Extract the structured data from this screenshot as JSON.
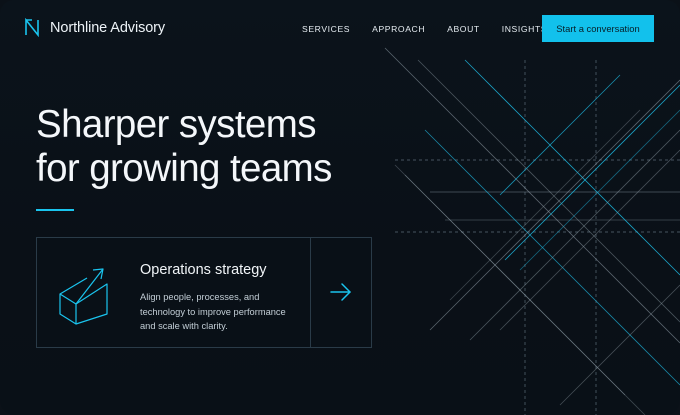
{
  "header": {
    "brand": "Northline Advisory",
    "logo_icon": "n-monogram-icon",
    "nav": [
      "SERVICES",
      "APPROACH",
      "ABOUT",
      "INSIGHTS"
    ],
    "cta_label": "Start a conversation"
  },
  "hero": {
    "headline_line1": "Sharper systems",
    "headline_line2": "for growing teams"
  },
  "card": {
    "icon": "growth-chart-arrow-icon",
    "title": "Operations strategy",
    "description": "Align people, processes, and technology to improve performance and scale with clarity.",
    "arrow_icon": "arrow-right-icon"
  },
  "colors": {
    "background": "#0b1118",
    "accent": "#12c1ec",
    "text": "#f4f7fa",
    "muted_text": "#c3ced6",
    "border": "#2a3b48"
  }
}
